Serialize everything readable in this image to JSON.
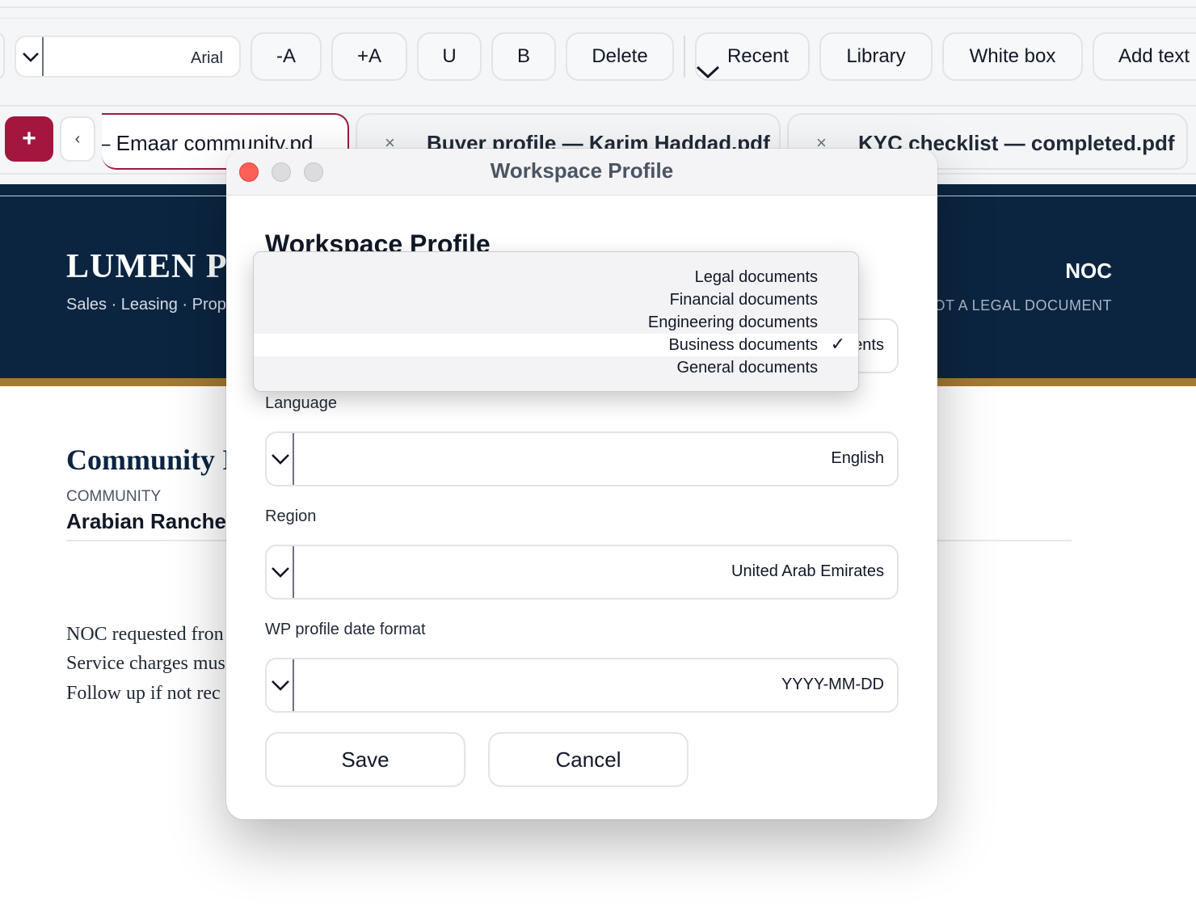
{
  "toolbar": {
    "font_value": "Arial",
    "buttons": [
      "-A",
      "+A",
      "U",
      "B",
      "Delete",
      "Recent",
      "Library",
      "White box",
      "Add text"
    ]
  },
  "tabs": [
    {
      "label": "– Emaar community.pd",
      "active": true
    },
    {
      "label": "Buyer profile — Karim Haddad.pdf",
      "active": false
    },
    {
      "label": "KYC checklist — completed.pdf",
      "active": false
    }
  ],
  "tab_close_glyph": "×",
  "add_tab_glyph": "+",
  "prev_glyph": "‹",
  "document": {
    "brand": "LUMEN PI",
    "brand_sub": "Sales · Leasing · Prop",
    "noc_title": "NOC",
    "noc_note": "OT A LEGAL DOCUMENT",
    "heading": "Community I",
    "community_label": "COMMUNITY",
    "community_value": "Arabian Ranche",
    "lines": [
      "NOC requested fron",
      "Service charges mus",
      "Follow up if not rec"
    ]
  },
  "modal": {
    "window_title": "Workspace Profile",
    "heading": "Workspace Profile",
    "document_type_value_fragment": "ents",
    "language_label": "Language",
    "language_value": "English",
    "region_label": "Region",
    "region_value": "United Arab Emirates",
    "date_format_label": "WP profile date format",
    "date_format_value": "YYYY-MM-DD",
    "save_label": "Save",
    "cancel_label": "Cancel"
  },
  "menu": {
    "items": [
      "Legal documents",
      "Financial documents",
      "Engineering documents",
      "Business documents",
      "General documents"
    ],
    "selected_index": 3,
    "check_glyph": "✓"
  },
  "colors": {
    "accent": "#a3173f",
    "banner": "#0b2540",
    "gold": "#a47a2c",
    "close_red": "#fe5f57"
  },
  "icons": {
    "chevron": "chevron-down-icon",
    "close": "close-icon",
    "check": "checkmark-icon"
  }
}
